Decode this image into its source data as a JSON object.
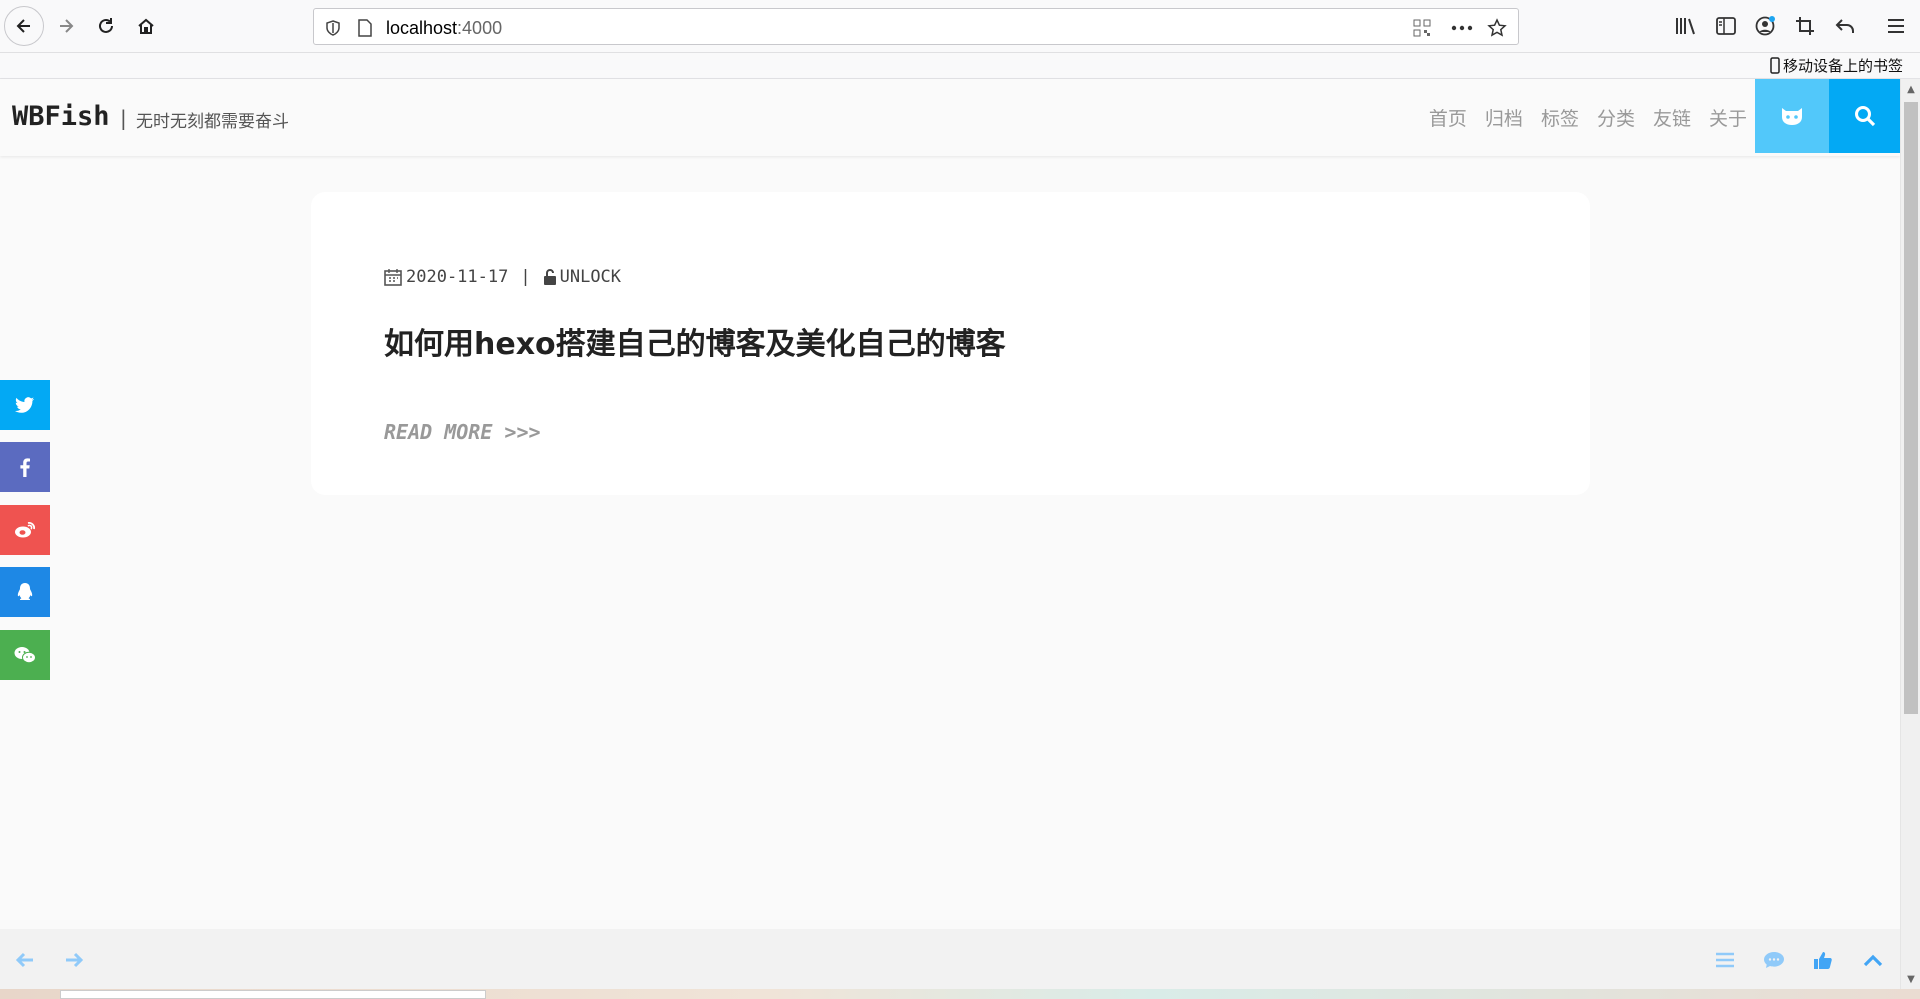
{
  "browser": {
    "url_host": "localhost",
    "url_port": ":4000",
    "bookmark_label": "移动设备上的书签"
  },
  "site": {
    "logo": "WBFish",
    "separator": "|",
    "slogan": "无时无刻都需要奋斗",
    "nav": [
      {
        "label": "首页"
      },
      {
        "label": "归档"
      },
      {
        "label": "标签"
      },
      {
        "label": "分类"
      },
      {
        "label": "友链"
      },
      {
        "label": "关于"
      }
    ]
  },
  "share": {
    "items": [
      {
        "icon": "twitter-icon",
        "color": "#03a9f4"
      },
      {
        "icon": "facebook-icon",
        "color": "#5b6bc0"
      },
      {
        "icon": "weibo-icon",
        "color": "#ef5350"
      },
      {
        "icon": "qq-icon",
        "color": "#1e88e5"
      },
      {
        "icon": "wechat-icon",
        "color": "#4caf50"
      }
    ]
  },
  "post": {
    "date": "2020-11-17",
    "separator": "|",
    "lock_status": "UNLOCK",
    "title": "如何用hexo搭建自己的博客及美化自己的博客",
    "read_more": "READ MORE >>>"
  },
  "colors": {
    "accent": "#03a9f4",
    "github_button": "#52c8fa",
    "bottom_icons": "#90caf9"
  }
}
